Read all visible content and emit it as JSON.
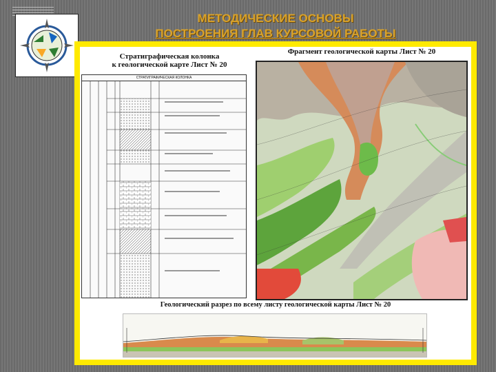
{
  "slide": {
    "title_line1": "МЕТОДИЧЕСКИЕ ОСНОВЫ",
    "title_line2": "ПОСТРОЕНИЯ ГЛАВ КУРСОВОЙ РАБОТЫ"
  },
  "stratigraphic_column": {
    "title_line1": "Стратиграфическая колонка",
    "title_line2": "к геологической карте Лист № 20",
    "header": "СТРАТИГРАФИЧЕСКАЯ КОЛОНКА"
  },
  "map": {
    "title": "Фрагмент геологической карты Лист № 20"
  },
  "cross_section": {
    "title": "Геологический разрез по всему листу геологической карты Лист № 20"
  },
  "colors": {
    "title": "#d9a22a",
    "frame": "#ffea00",
    "background": "#6e6e6e"
  }
}
